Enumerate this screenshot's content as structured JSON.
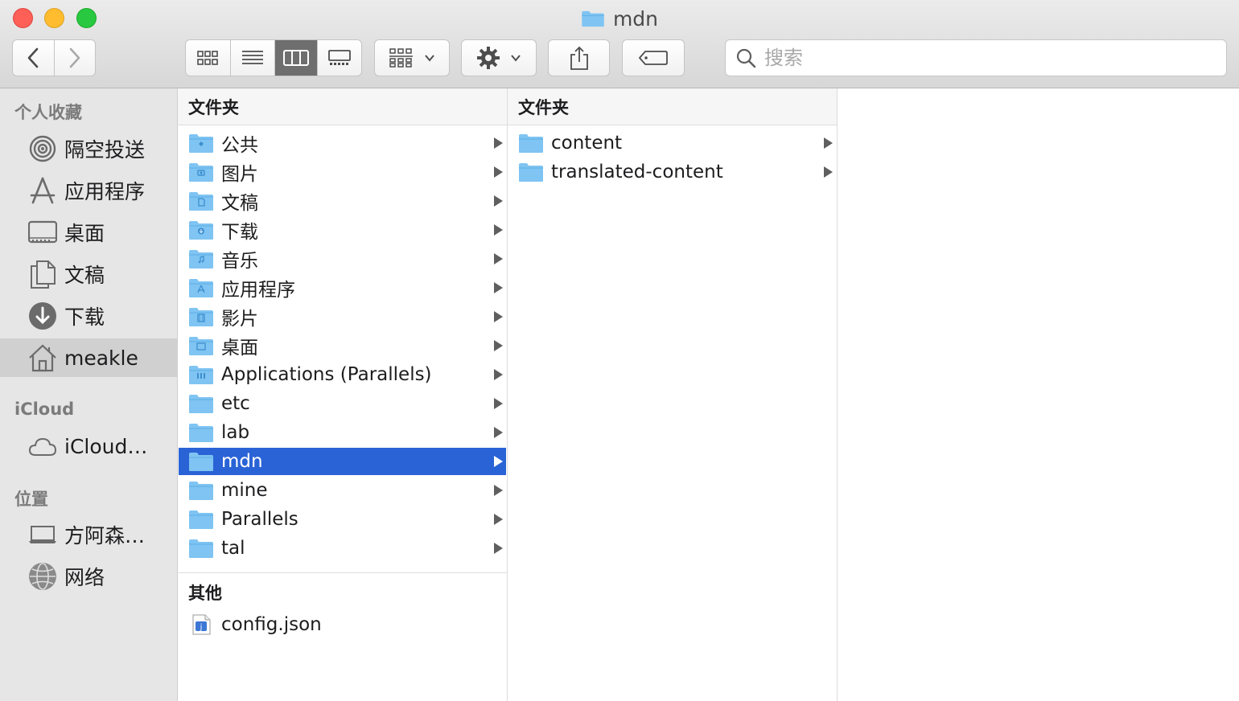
{
  "window": {
    "title": "mdn"
  },
  "toolbar": {
    "back_icon": "chevron-left-icon",
    "forward_icon": "chevron-right-icon",
    "view_modes": [
      "icon-view-icon",
      "list-view-icon",
      "column-view-icon",
      "gallery-view-icon"
    ],
    "active_view": "column-view-icon",
    "group_icon": "group-icon",
    "action_icon": "gear-icon",
    "share_icon": "share-icon",
    "tag_icon": "tag-icon",
    "search_placeholder": "搜索",
    "colors": {
      "selected_view": "#6e6e6e"
    }
  },
  "sidebar": {
    "favorites_title": "个人收藏",
    "favorites": [
      {
        "label": "隔空投送",
        "icon": "airdrop-icon"
      },
      {
        "label": "应用程序",
        "icon": "applications-icon"
      },
      {
        "label": "桌面",
        "icon": "desktop-icon"
      },
      {
        "label": "文稿",
        "icon": "documents-icon"
      },
      {
        "label": "下载",
        "icon": "downloads-icon"
      },
      {
        "label": "meakle",
        "icon": "home-icon",
        "selected": true
      }
    ],
    "icloud_title": "iCloud",
    "icloud": [
      {
        "label": "iCloud…",
        "icon": "cloud-icon"
      }
    ],
    "locations_title": "位置",
    "locations": [
      {
        "label": "方阿森…",
        "icon": "laptop-icon"
      },
      {
        "label": "网络",
        "icon": "network-icon"
      }
    ]
  },
  "column1": {
    "header": "文件夹",
    "folders": [
      {
        "name": "公共",
        "icon": "public-folder-icon"
      },
      {
        "name": "图片",
        "icon": "pictures-folder-icon"
      },
      {
        "name": "文稿",
        "icon": "documents-folder-icon"
      },
      {
        "name": "下载",
        "icon": "downloads-folder-icon"
      },
      {
        "name": "音乐",
        "icon": "music-folder-icon"
      },
      {
        "name": "应用程序",
        "icon": "applications-folder-icon"
      },
      {
        "name": "影片",
        "icon": "movies-folder-icon"
      },
      {
        "name": "桌面",
        "icon": "desktop-folder-icon"
      },
      {
        "name": "Applications (Parallels)",
        "icon": "parallels-apps-folder-icon"
      },
      {
        "name": "etc",
        "icon": "folder-icon"
      },
      {
        "name": "lab",
        "icon": "folder-icon"
      },
      {
        "name": "mdn",
        "icon": "folder-icon",
        "selected": true
      },
      {
        "name": "mine",
        "icon": "folder-icon"
      },
      {
        "name": "Parallels",
        "icon": "folder-icon"
      },
      {
        "name": "tal",
        "icon": "folder-icon"
      }
    ],
    "other_header": "其他",
    "files": [
      {
        "name": "config.json",
        "icon": "json-file-icon"
      }
    ]
  },
  "column2": {
    "header": "文件夹",
    "folders": [
      {
        "name": "content",
        "icon": "folder-icon"
      },
      {
        "name": "translated-content",
        "icon": "folder-icon"
      }
    ]
  },
  "colors": {
    "selection": "#2a63d6",
    "folder": "#7fc4f2",
    "sidebar_bg": "#e6e6e6"
  }
}
